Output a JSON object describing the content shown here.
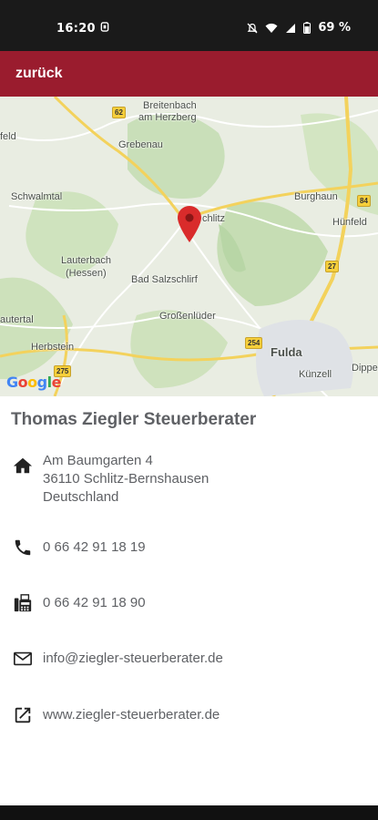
{
  "status_bar": {
    "time": "16:20",
    "battery_text": "69 %"
  },
  "app_bar": {
    "back_label": "zurück",
    "color": "#9a1c2e"
  },
  "map": {
    "labels": {
      "breitenbach": "Breitenbach",
      "am_herzberg": "am Herzberg",
      "feld": "feld",
      "grebenau": "Grebenau",
      "schwalmtal": "Schwalmtal",
      "burghaun": "Burghaun",
      "schlitz": "chlitz",
      "huenfeld": "Hünfeld",
      "lauterbach": "Lauterbach",
      "hessen": "(Hessen)",
      "bad_salzschlirf": "Bad Salzschlirf",
      "autertal": "autertal",
      "grossenlueder": "Großenlüder",
      "fulda": "Fulda",
      "herbstein": "Herbstein",
      "dipp": "Dippe",
      "kuenzell": "Künzell"
    },
    "shields": {
      "s62": "62",
      "s84": "84",
      "s27": "27",
      "s254": "254",
      "s275": "275"
    },
    "attribution": "Google"
  },
  "business": {
    "name": "Thomas Ziegler Steuerberater",
    "address": {
      "street": "Am Baumgarten 4",
      "city": "36110 Schlitz-Bernshausen",
      "country": "Deutschland"
    },
    "phone": "0 66 42 91 18 19",
    "fax": "0 66 42 91 18 90",
    "email": "info@ziegler-steuerberater.de",
    "website": "www.ziegler-steuerberater.de"
  },
  "icons": [
    "home-icon",
    "phone-icon",
    "fax-icon",
    "mail-icon",
    "external-link-icon"
  ]
}
